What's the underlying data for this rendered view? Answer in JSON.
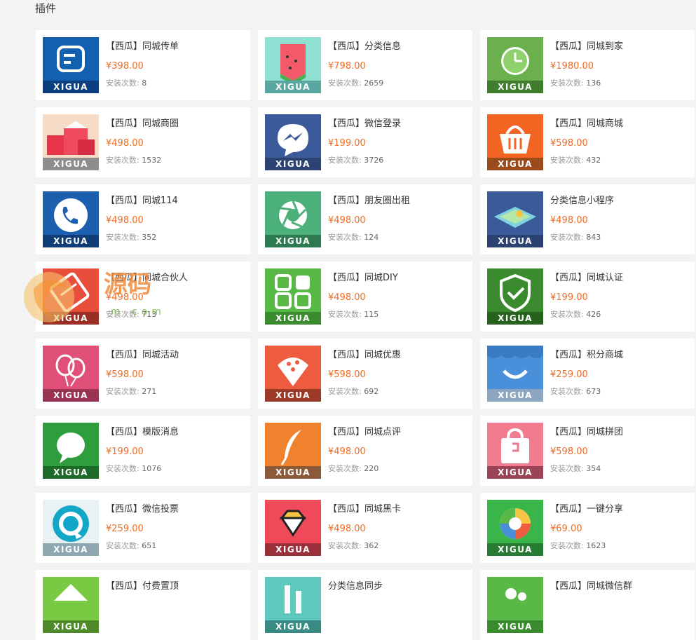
{
  "section_title": "插件",
  "install_label": "安装次数: ",
  "brand_text": "XIGUA",
  "plugins": [
    {
      "name": "【西瓜】同城传单",
      "price": "¥398.00",
      "installs": "8",
      "icon": "chat-square-icon",
      "bg": "#1460b0",
      "band": "#0b3f80"
    },
    {
      "name": "【西瓜】分类信息",
      "price": "¥798.00",
      "installs": "2659",
      "icon": "watermelon-icon",
      "bg": "#8fe0d2",
      "band": "#5aa6a0"
    },
    {
      "name": "【西瓜】同城到家",
      "price": "¥1980.00",
      "installs": "136",
      "icon": "clock-icon",
      "bg": "#6ab04c",
      "band": "#3f7d2c"
    },
    {
      "name": "【西瓜】同城商圈",
      "price": "¥498.00",
      "installs": "1532",
      "icon": "gift-boxes-icon",
      "bg": "#f6dcc6",
      "band": "#8d8d8d"
    },
    {
      "name": "【西瓜】微信登录",
      "price": "¥199.00",
      "installs": "3726",
      "icon": "messenger-bolt-icon",
      "bg": "#3b5a9a",
      "band": "#2b4272"
    },
    {
      "name": "【西瓜】同城商城",
      "price": "¥598.00",
      "installs": "432",
      "icon": "basket-icon",
      "bg": "#f26522",
      "band": "#9b4a1c"
    },
    {
      "name": "【西瓜】同城114",
      "price": "¥498.00",
      "installs": "352",
      "icon": "phone-icon",
      "bg": "#1b5fae",
      "band": "#0e3d78"
    },
    {
      "name": "【西瓜】朋友圈出租",
      "price": "¥498.00",
      "installs": "124",
      "icon": "aperture-icon",
      "bg": "#4cb07a",
      "band": "#2e7a50"
    },
    {
      "name": "分类信息小程序",
      "price": "¥498.00",
      "installs": "843",
      "icon": "map-icon",
      "bg": "#3b5a9a",
      "band": "#2b4272"
    },
    {
      "name": "【西瓜】同城合伙人",
      "price": "¥498.00",
      "installs": "713",
      "icon": "handshake-icon",
      "bg": "#e94e3c",
      "band": "#9a2e24"
    },
    {
      "name": "【西瓜】同城DIY",
      "price": "¥498.00",
      "installs": "115",
      "icon": "grid-icon",
      "bg": "#58b947",
      "band": "#3a8a2e"
    },
    {
      "name": "【西瓜】同城认证",
      "price": "¥199.00",
      "installs": "426",
      "icon": "shield-check-icon",
      "bg": "#3a8a2e",
      "band": "#26611d"
    },
    {
      "name": "【西瓜】同城活动",
      "price": "¥598.00",
      "installs": "271",
      "icon": "balloons-icon",
      "bg": "#e04f78",
      "band": "#9a3352"
    },
    {
      "name": "【西瓜】同城优惠",
      "price": "¥598.00",
      "installs": "692",
      "icon": "pie-icon",
      "bg": "#ee5c3f",
      "band": "#9a3a27"
    },
    {
      "name": "【西瓜】积分商城",
      "price": "¥259.00",
      "installs": "673",
      "icon": "smile-bag-icon",
      "bg": "#4a8fd9",
      "band": "#8da6bf"
    },
    {
      "name": "【西瓜】模版消息",
      "price": "¥199.00",
      "installs": "1076",
      "icon": "speech-bubble-icon",
      "bg": "#2e9d3e",
      "band": "#1d6a29"
    },
    {
      "name": "【西瓜】同城点评",
      "price": "¥498.00",
      "installs": "220",
      "icon": "feather-icon",
      "bg": "#f0822d",
      "band": "#8a5a3a"
    },
    {
      "name": "【西瓜】同城拼团",
      "price": "¥598.00",
      "installs": "354",
      "icon": "shopping-bag-icon",
      "bg": "#f07a8e",
      "band": "#9a4456"
    },
    {
      "name": "【西瓜】微信投票",
      "price": "¥259.00",
      "installs": "651",
      "icon": "refresh-circle-icon",
      "bg": "#e8f1f4",
      "band": "#8da6b0"
    },
    {
      "name": "【西瓜】同城黑卡",
      "price": "¥498.00",
      "installs": "362",
      "icon": "diamond-icon",
      "bg": "#f04a5a",
      "band": "#9a2e3a"
    },
    {
      "name": "【西瓜】一键分享",
      "price": "¥69.00",
      "installs": "1623",
      "icon": "color-aperture-icon",
      "bg": "#39b54a",
      "band": "#267a31"
    },
    {
      "name": "【西瓜】付费置顶",
      "price": "",
      "installs": "",
      "icon": "arrow-up-icon",
      "bg": "#7ac943",
      "band": "#4f8a2a"
    },
    {
      "name": "分类信息同步",
      "price": "",
      "installs": "",
      "icon": "sync-icon",
      "bg": "#5fc9c0",
      "band": "#3a8a84"
    },
    {
      "name": "【西瓜】同城微信群",
      "price": "",
      "installs": "",
      "icon": "group-icon",
      "bg": "#58b947",
      "band": "#3a8a2e"
    }
  ],
  "watermark": {
    "text": "源码",
    "sub": "m.com"
  }
}
